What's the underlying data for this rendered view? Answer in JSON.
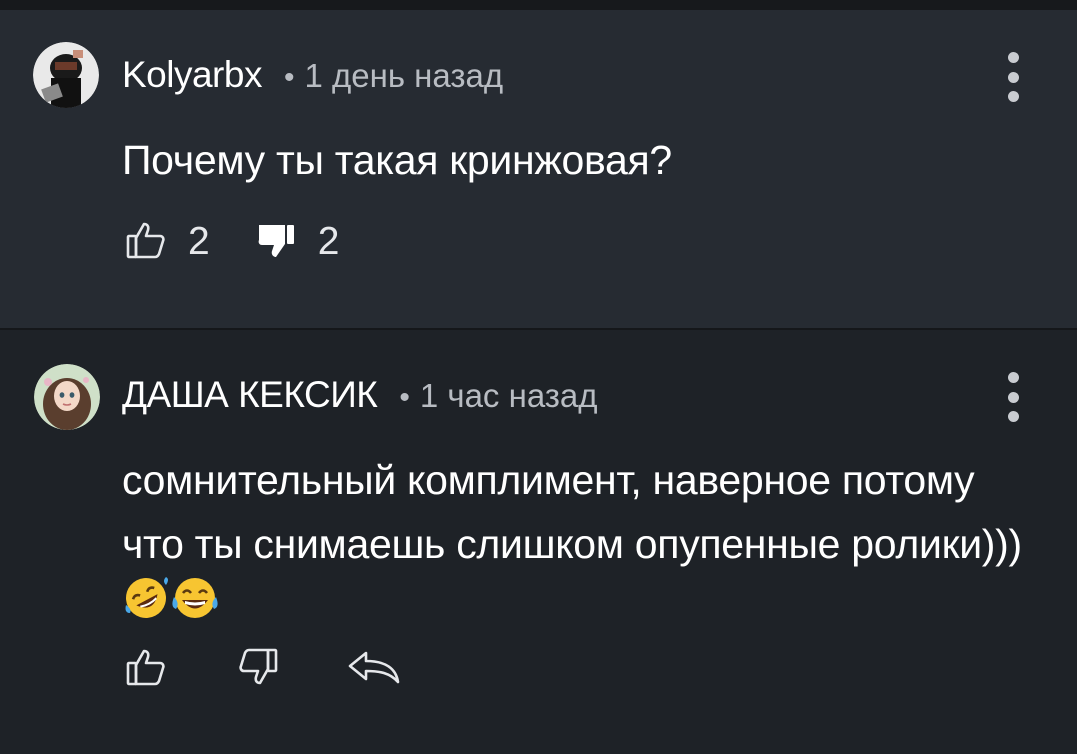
{
  "comments": [
    {
      "author": "Kolyarbx",
      "separator": "•",
      "time": "1 день назад",
      "text": "Почему ты такая кринжовая?",
      "likes": "2",
      "dislikes": "2",
      "avatar_icon": "user-avatar",
      "menu_icon": "more-vert-icon"
    },
    {
      "author": "ДАША КЕКСИК",
      "separator": "•",
      "time": "1 час назад",
      "text": "сомнительный комплимент, наверное потому что ты снимаешь слишком опупенные ролики)))",
      "emojis": [
        "rolling-on-floor-laughing-emoji",
        "face-with-tears-of-joy-emoji"
      ],
      "avatar_icon": "user-avatar",
      "menu_icon": "more-vert-icon"
    }
  ],
  "colors": {
    "panel_first": "#262b32",
    "panel_second": "#1e2227",
    "text_primary": "#ffffff",
    "text_secondary": "#b8bcc2"
  }
}
